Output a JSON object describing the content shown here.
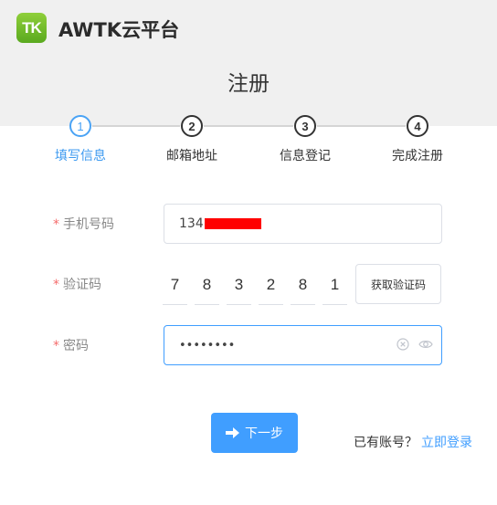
{
  "header": {
    "logo_text": "TK",
    "brand": "AWTK云平台",
    "page_title": "注册"
  },
  "steps": [
    {
      "number": "1",
      "label": "填写信息",
      "active": true
    },
    {
      "number": "2",
      "label": "邮箱地址",
      "active": false
    },
    {
      "number": "3",
      "label": "信息登记",
      "active": false
    },
    {
      "number": "4",
      "label": "完成注册",
      "active": false
    }
  ],
  "form": {
    "required_mark": "*",
    "phone_label": "手机号码",
    "phone_value": "134",
    "code_label": "验证码",
    "code_digits": [
      "7",
      "8",
      "3",
      "2",
      "8",
      "1"
    ],
    "get_code_button": "获取验证码",
    "password_label": "密码",
    "password_masked": "••••••••"
  },
  "footer": {
    "next_button": "下一步",
    "has_account": "已有账号？",
    "login_link": "立即登录"
  },
  "colors": {
    "accent": "#409eff",
    "required": "#f56c6c",
    "logo_green": "#6ab82b"
  }
}
